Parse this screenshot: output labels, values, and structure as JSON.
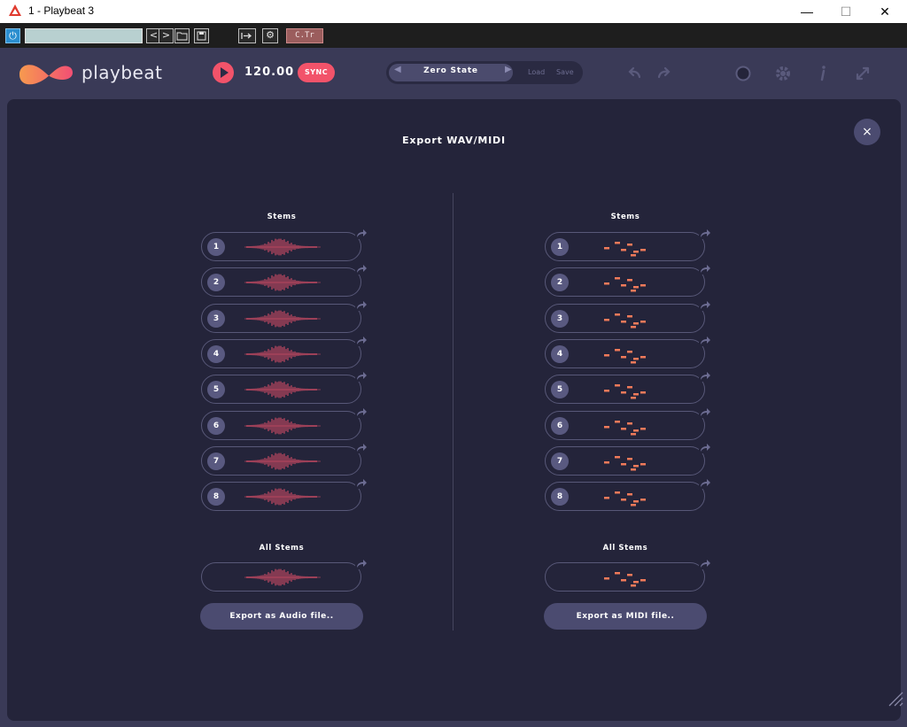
{
  "window": {
    "title": "1 - Playbeat 3",
    "minimize": "—",
    "maximize": "☐",
    "close": "✕"
  },
  "host": {
    "prev": "<",
    "next": ">",
    "ctr_label": "C.Tr"
  },
  "app": {
    "logo_text": "playbeat",
    "tempo": "120.00",
    "sync_label": "SYNC",
    "preset": {
      "name": "Zero State",
      "load_label": "Load",
      "save_label": "Save"
    }
  },
  "export_panel": {
    "title": "Export WAV/MIDI",
    "close_glyph": "×",
    "audio": {
      "stems_label": "Stems",
      "stems": [
        "1",
        "2",
        "3",
        "4",
        "5",
        "6",
        "7",
        "8"
      ],
      "all_stems_label": "All Stems",
      "export_label": "Export as Audio file.."
    },
    "midi": {
      "stems_label": "Stems",
      "stems": [
        "1",
        "2",
        "3",
        "4",
        "5",
        "6",
        "7",
        "8"
      ],
      "all_stems_label": "All Stems",
      "export_label": "Export as MIDI file.."
    }
  },
  "colors": {
    "accent": "#f2536a",
    "wave": "#e5506a",
    "midi": "#f07a5a",
    "panel_bg": "#24243a",
    "header_bg": "#3a3a57"
  }
}
